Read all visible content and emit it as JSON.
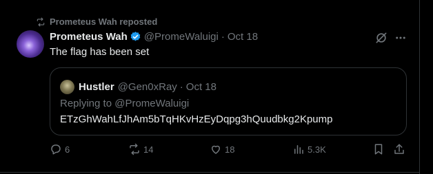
{
  "repost_header": {
    "label": "Prometeus Wah reposted"
  },
  "post": {
    "author_name": "Prometeus Wah",
    "handle": "@PromeWaluigi",
    "separator": "·",
    "time": "Oct 18",
    "text": "The flag has been set",
    "verified_color": "#1d9bf0"
  },
  "quote": {
    "author_name": "Hustler",
    "handle": "@Gen0xRay",
    "separator": "·",
    "time": "Oct 18",
    "reply_prefix": "Replying to",
    "reply_handle": "@PromeWaluigi",
    "text": "ETzGhWahLfJhAm5bTqHKvHzEyDqpg3hQuudbkg2Kpump"
  },
  "actions": {
    "replies": "6",
    "reposts": "14",
    "likes": "18",
    "views": "5.3K"
  },
  "icons": [
    "repost-icon",
    "verified-badge-icon",
    "grok-icon",
    "more-icon",
    "reply-icon",
    "like-icon",
    "views-icon",
    "bookmark-icon",
    "share-icon"
  ]
}
